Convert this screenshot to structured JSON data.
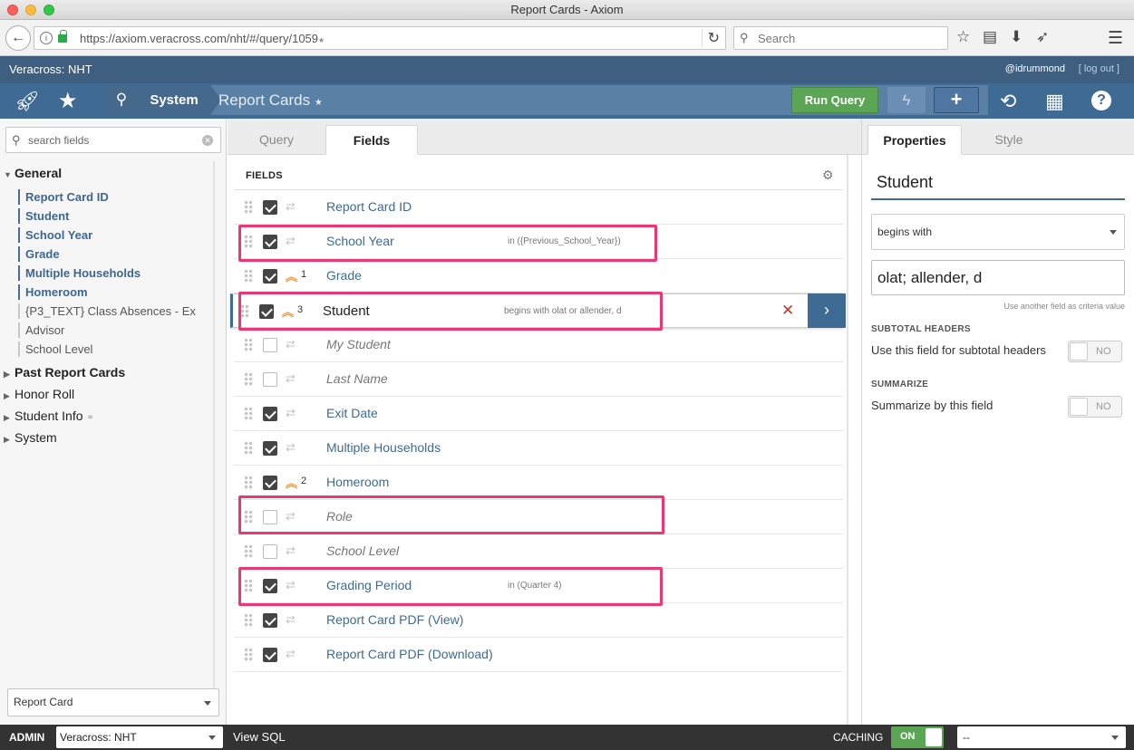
{
  "window": {
    "title": "Report Cards - Axiom"
  },
  "browser": {
    "url": "https://axiom.veracross.com/nht/#/query/1059",
    "url_star": "★",
    "search_placeholder": "Search"
  },
  "app": {
    "brand": "Veracross: NHT",
    "user": "@idrummond",
    "logout": "[ log out ]",
    "breadcrumb_system": "System",
    "breadcrumb_current": "Report Cards",
    "breadcrumb_modified": "★",
    "run_query": "Run Query"
  },
  "sidebar": {
    "search_placeholder": "search fields",
    "groups": {
      "general": "General",
      "past_report_cards": "Past Report Cards",
      "honor_roll": "Honor Roll",
      "student_info": "Student Info",
      "system": "System"
    },
    "general_items": [
      "Report Card ID",
      "Student",
      "School Year",
      "Grade",
      "Multiple Households",
      "Homeroom",
      "{P3_TEXT} Class Absences - Ex",
      "Advisor",
      "School Level"
    ],
    "object_select": "Report Card"
  },
  "center": {
    "tabs": {
      "query": "Query",
      "fields": "Fields"
    },
    "fields_header": "FIELDS",
    "rows": [
      {
        "name": "Report Card ID",
        "criteria": "",
        "sort": ""
      },
      {
        "name": "School Year",
        "criteria": "in ({Previous_School_Year})",
        "sort": ""
      },
      {
        "name": "Grade",
        "criteria": "",
        "sort": "1"
      },
      {
        "name": "Student",
        "criteria": "begins with olat or allender, d",
        "sort": "3"
      },
      {
        "name": "My Student",
        "criteria": "",
        "sort": ""
      },
      {
        "name": "Last Name",
        "criteria": "",
        "sort": ""
      },
      {
        "name": "Exit Date",
        "criteria": "",
        "sort": ""
      },
      {
        "name": "Multiple Households",
        "criteria": "",
        "sort": ""
      },
      {
        "name": "Homeroom",
        "criteria": "",
        "sort": "2"
      },
      {
        "name": "Role",
        "criteria": "",
        "sort": ""
      },
      {
        "name": "School Level",
        "criteria": "",
        "sort": ""
      },
      {
        "name": "Grading Period",
        "criteria": "in (Quarter 4)",
        "sort": ""
      },
      {
        "name": "Report Card PDF (View)",
        "criteria": "",
        "sort": ""
      },
      {
        "name": "Report Card PDF (Download)",
        "criteria": "",
        "sort": ""
      }
    ]
  },
  "properties": {
    "tabs": {
      "properties": "Properties",
      "style": "Style"
    },
    "field_title": "Student",
    "operator": "begins with",
    "criteria_value": "olat; allender, d",
    "hint": "Use another field as criteria value",
    "subtotal_header": "SUBTOTAL HEADERS",
    "subtotal_label": "Use this field for subtotal headers",
    "subtotal_value": "NO",
    "summarize_header": "SUMMARIZE",
    "summarize_label": "Summarize by this field",
    "summarize_value": "NO"
  },
  "footer": {
    "admin": "ADMIN",
    "school_select": "Veracross: NHT",
    "view_sql": "View SQL",
    "caching": "CACHING",
    "caching_value": "ON",
    "cache_select": "--"
  }
}
